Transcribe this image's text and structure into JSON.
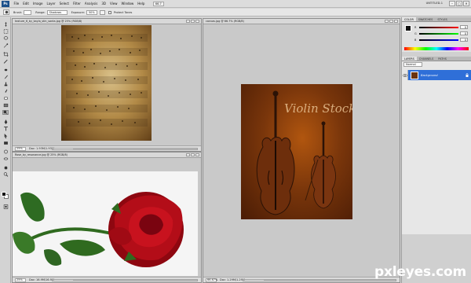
{
  "app": {
    "logo": "Ps"
  },
  "menu": [
    "File",
    "Edit",
    "Image",
    "Layer",
    "Select",
    "Filter",
    "Analysis",
    "3D",
    "View",
    "Window",
    "Help"
  ],
  "menu_right": {
    "zoom": "66.7"
  },
  "workspace": "UNTITLED-1",
  "window_controls": {
    "minimize": "–",
    "maximize": "□",
    "close": "✕"
  },
  "options_bar": {
    "brush_label": "Brush:",
    "range_label": "Range:",
    "range_value": "Shadows",
    "exposure_label": "Exposure:",
    "exposure_value": "50%",
    "protect_tones": "Protect Tones"
  },
  "documents": {
    "music": {
      "title": "texture_6_by_kayla_stin_santa.jpg @ 25% (RGB/8)",
      "zoom": "25%",
      "doc": "Doc: 1.93M/1.93M"
    },
    "rose": {
      "title": "Rose_by_resonance.jpg @ 25% (RGB/8)",
      "zoom": "25%",
      "doc": "Doc: 16.9M/16.9M"
    },
    "canvas": {
      "title": "canvas.jpg @ 66.7% (RGB/8)",
      "zoom": "66.67%",
      "doc": "Doc: 1.29M/1.29M",
      "artwork_text": "Violin Stock"
    }
  },
  "panels": {
    "color_tabs": [
      "COLOR",
      "SWATCHES",
      "STYLES"
    ],
    "sliders": [
      {
        "label": "R",
        "value": "0",
        "color": "#e23a3a"
      },
      {
        "label": "G",
        "value": "0",
        "color": "#3ab24a"
      },
      {
        "label": "B",
        "value": "0",
        "color": "#3a5ae2"
      }
    ],
    "layer_tabs": [
      "LAYERS",
      "CHANNELS",
      "PATHS"
    ],
    "blend_mode": "Normal",
    "layers": [
      {
        "name": "Background"
      }
    ]
  },
  "watermark": "pxleyes.com",
  "colors": {
    "accent": "#2f6fd8"
  }
}
